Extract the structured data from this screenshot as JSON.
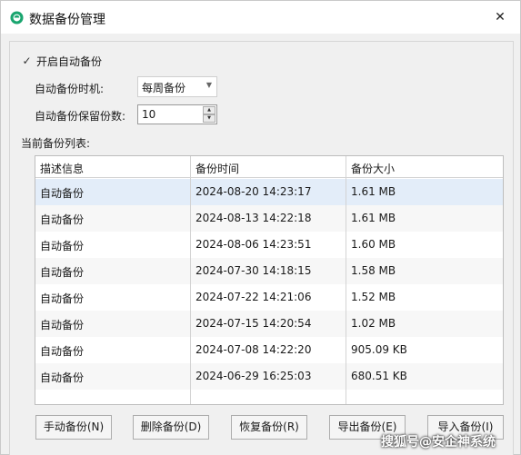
{
  "window": {
    "title": "数据备份管理",
    "close_symbol": "✕"
  },
  "settings": {
    "auto_backup_checked": true,
    "checkbox_mark": "✓",
    "auto_backup_label": "开启自动备份",
    "backup_timing_label": "自动备份时机:",
    "backup_timing_value": "每周备份",
    "select_arrow": "▼",
    "keep_count_label": "自动备份保留份数:",
    "keep_count_value": "10",
    "spin_up": "▲",
    "spin_down": "▼"
  },
  "backup_list": {
    "label": "当前备份列表:",
    "columns": [
      "描述信息",
      "备份时间",
      "备份大小"
    ],
    "rows": [
      {
        "desc": "自动备份",
        "time": "2024-08-20 14:23:17",
        "size": "1.61 MB"
      },
      {
        "desc": "自动备份",
        "time": "2024-08-13 14:22:18",
        "size": "1.61 MB"
      },
      {
        "desc": "自动备份",
        "time": "2024-08-06 14:23:51",
        "size": "1.60 MB"
      },
      {
        "desc": "自动备份",
        "time": "2024-07-30 14:18:15",
        "size": "1.58 MB"
      },
      {
        "desc": "自动备份",
        "time": "2024-07-22 14:21:06",
        "size": "1.52 MB"
      },
      {
        "desc": "自动备份",
        "time": "2024-07-15 14:20:54",
        "size": "1.02 MB"
      },
      {
        "desc": "自动备份",
        "time": "2024-07-08 14:22:20",
        "size": "905.09 KB"
      },
      {
        "desc": "自动备份",
        "time": "2024-06-29 16:25:03",
        "size": "680.51 KB"
      }
    ],
    "selected_index": 0
  },
  "buttons": {
    "manual_backup": "手动备份(N)",
    "delete_backup": "删除备份(D)",
    "restore_backup": "恢复备份(R)",
    "export_backup": "导出备份(E)",
    "import_backup": "导入备份(I)"
  },
  "watermark": {
    "text": "搜狐号@安企神系统"
  },
  "colors": {
    "accent": "#1aa56f",
    "selected_row": "#e3edf9"
  }
}
